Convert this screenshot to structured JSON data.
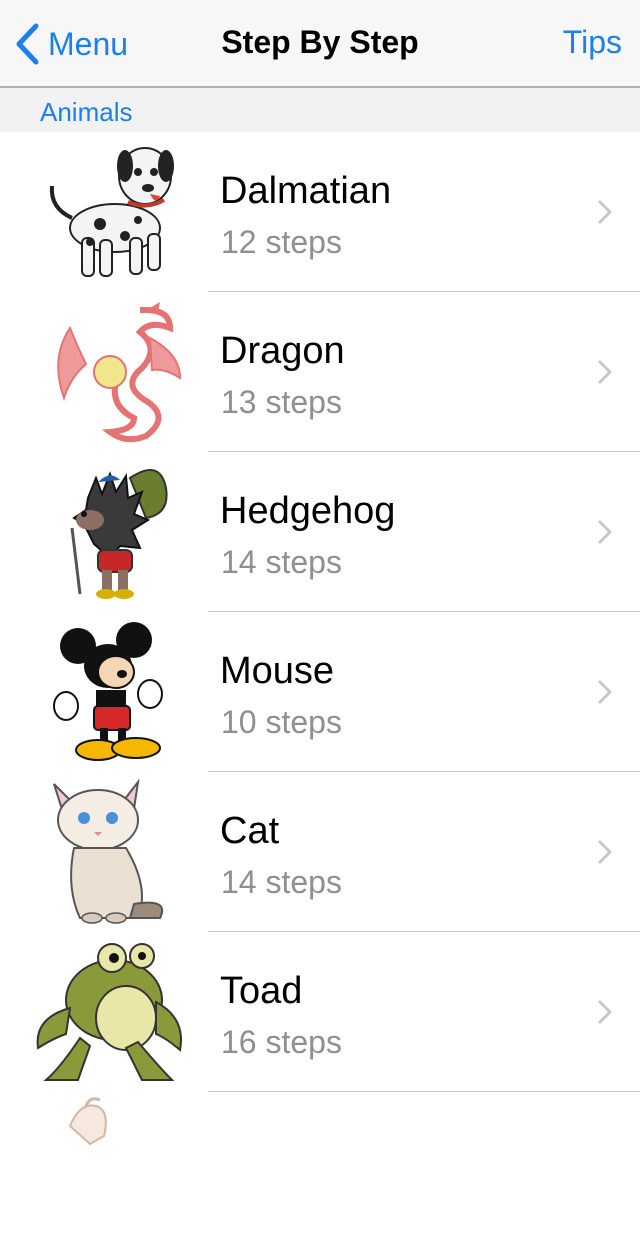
{
  "navbar": {
    "back_label": "Menu",
    "title": "Step By Step",
    "right_label": "Tips"
  },
  "section": {
    "title": "Animals"
  },
  "items": [
    {
      "name": "Dalmatian",
      "steps": "12 steps",
      "icon": "dalmatian-icon"
    },
    {
      "name": "Dragon",
      "steps": "13 steps",
      "icon": "dragon-icon"
    },
    {
      "name": "Hedgehog",
      "steps": "14 steps",
      "icon": "hedgehog-icon"
    },
    {
      "name": "Mouse",
      "steps": "10 steps",
      "icon": "mouse-icon"
    },
    {
      "name": "Cat",
      "steps": "14 steps",
      "icon": "cat-icon"
    },
    {
      "name": "Toad",
      "steps": "16 steps",
      "icon": "toad-icon"
    }
  ],
  "colors": {
    "accent": "#1a80f0",
    "subtitle": "#8e8e93",
    "separator": "#c8c7cc"
  }
}
